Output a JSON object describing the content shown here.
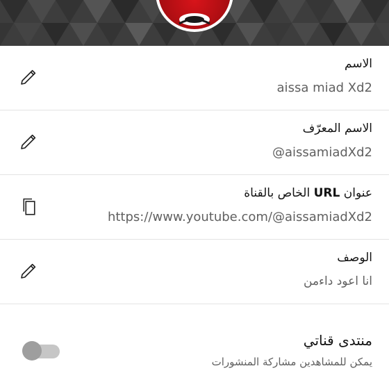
{
  "fields": {
    "name": {
      "label": "الاسم",
      "value": "aissa miad Xd2",
      "icon": "pencil-icon"
    },
    "handle": {
      "label": "الاسم المعرّف",
      "value": "@aissamiadXd2",
      "icon": "pencil-icon"
    },
    "url": {
      "label_prefix": "عنوان ",
      "label_url": "URL",
      "label_suffix": " الخاص بالقناة",
      "value": "https://www.youtube.com/@aissamiadXd2",
      "icon": "copy-icon"
    },
    "description": {
      "label": "الوصف",
      "value": "انا اعود داءمن",
      "icon": "pencil-icon"
    }
  },
  "forum": {
    "title": "منتدى قناتي",
    "subtitle": "يمكن للمشاهدين مشاركة المنشورات",
    "enabled": false
  },
  "colors": {
    "banner": "#3a3a3a",
    "avatar_red": "#d8141a",
    "text_primary": "#121212",
    "text_secondary": "#606060",
    "divider": "#e3e3e3"
  }
}
